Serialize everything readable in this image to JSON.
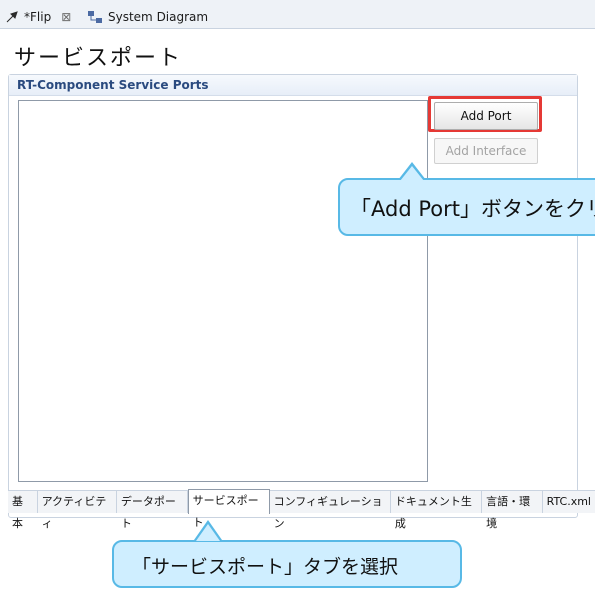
{
  "tabs": [
    {
      "label": "*Flip",
      "icon": "flip-icon",
      "close_icon": "close-icon"
    },
    {
      "label": "System Diagram",
      "icon": "system-diagram-icon"
    }
  ],
  "page": {
    "title": "サービスポート"
  },
  "section": {
    "header": "RT-Component Service Ports"
  },
  "buttons": {
    "add_port": "Add Port",
    "add_interface": "Add Interface"
  },
  "callouts": {
    "add_port": "「Add Port」ボタンをクリ",
    "tab_select": "「サービスポート」タブを選択"
  },
  "bottom_tabs": [
    {
      "label": "基本"
    },
    {
      "label": "アクティビティ"
    },
    {
      "label": "データポート"
    },
    {
      "label": "サービスポート"
    },
    {
      "label": "コンフィギュレーション"
    },
    {
      "label": "ドキュメント生成"
    },
    {
      "label": "言語・環境"
    },
    {
      "label": "RTC.xml"
    }
  ],
  "colors": {
    "highlight": "#e53935",
    "callout_fill": "#cfeeff",
    "callout_border": "#58b9e6"
  }
}
